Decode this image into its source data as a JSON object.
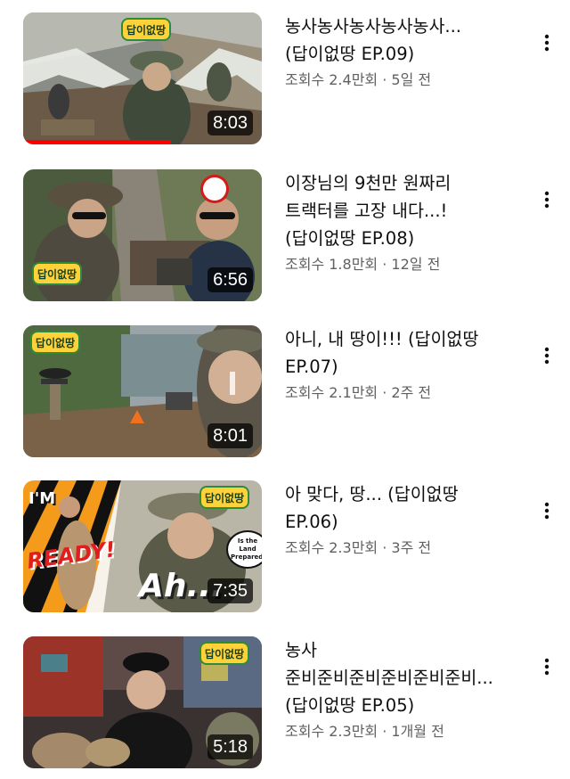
{
  "videos": [
    {
      "title_lines": [
        "농사농사농사농사농사...",
        "(답이없땅 EP.09)"
      ],
      "views": "조회수 2.4만회",
      "age": "5일 전",
      "duration": "8:03",
      "show_logo": "답이없땅",
      "watch_progress": 0.62
    },
    {
      "title_lines": [
        "이장님의 9천만 원짜리",
        "트랙터를 고장 내다...!",
        "(답이없땅 EP.08)"
      ],
      "views": "조회수 1.8만회",
      "age": "12일 전",
      "duration": "6:56",
      "show_logo": "답이없땅"
    },
    {
      "title_lines": [
        "아니, 내 땅이!!! (답이없땅",
        "EP.07)"
      ],
      "views": "조회수 2.1만회",
      "age": "2주 전",
      "duration": "8:01",
      "show_logo": "답이없땅"
    },
    {
      "title_lines": [
        "아 맞다, 땅... (답이없땅",
        "EP.06)"
      ],
      "views": "조회수 2.3만회",
      "age": "3주 전",
      "duration": "7:35",
      "show_logo": "답이없땅",
      "thumb_text": {
        "im": "I'M",
        "ready": "READY!",
        "bubble": "Is the Land Prepared?",
        "ah": "Ah..."
      }
    },
    {
      "title_lines": [
        "농사",
        "준비준비준비준비준비준비...",
        "(답이없땅 EP.05)"
      ],
      "views": "조회수 2.3만회",
      "age": "1개월 전",
      "duration": "5:18",
      "show_logo": "답이없땅"
    }
  ],
  "icons": {
    "menu": "more-vert-icon"
  },
  "colors": {
    "title": "#0f0f0f",
    "meta": "#606060",
    "progress": "#ff0000"
  }
}
